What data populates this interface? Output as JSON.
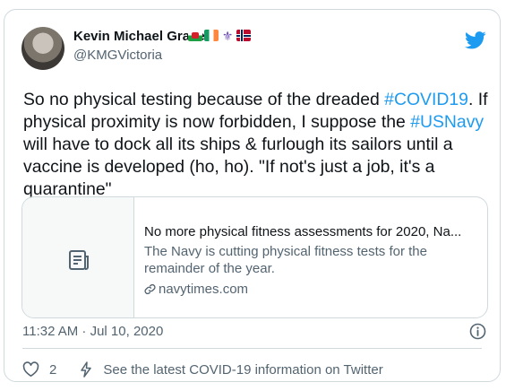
{
  "tweet": {
    "author_name": "Kevin Michael Grace",
    "author_handle": "@KMGVictoria",
    "name_emojis": [
      "wales-flag",
      "ireland-flag",
      "fleur-de-lis",
      "norway-flag"
    ],
    "text_parts": [
      "So no physical testing because of the dreaded ",
      "#COVID19",
      ". If physical proximity is now forbidden, I suppose the ",
      "#USNavy",
      " will have to dock all its ships & furlough its sailors until a vaccine is developed (ho, ho). \"If not's just a job, it's a quarantine\""
    ],
    "timestamp": "11:32 AM · Jul 10, 2020",
    "like_count": "2",
    "covid_info_label": "See the latest COVID-19 information on Twitter"
  },
  "link_preview": {
    "title": "No more physical fitness assessments for 2020, Na...",
    "description": "The Navy is cutting physical fitness tests for the remainder of the year.",
    "domain": "navytimes.com"
  },
  "icons": {
    "brand": "twitter-bird-icon",
    "preview_placeholder": "document-icon",
    "domain": "link-icon",
    "info": "info-icon",
    "like": "heart-icon",
    "flash": "lightning-icon"
  },
  "colors": {
    "accent": "#1d9bf0",
    "text": "#0f1419",
    "muted": "#536471",
    "border": "#cfd9de"
  }
}
